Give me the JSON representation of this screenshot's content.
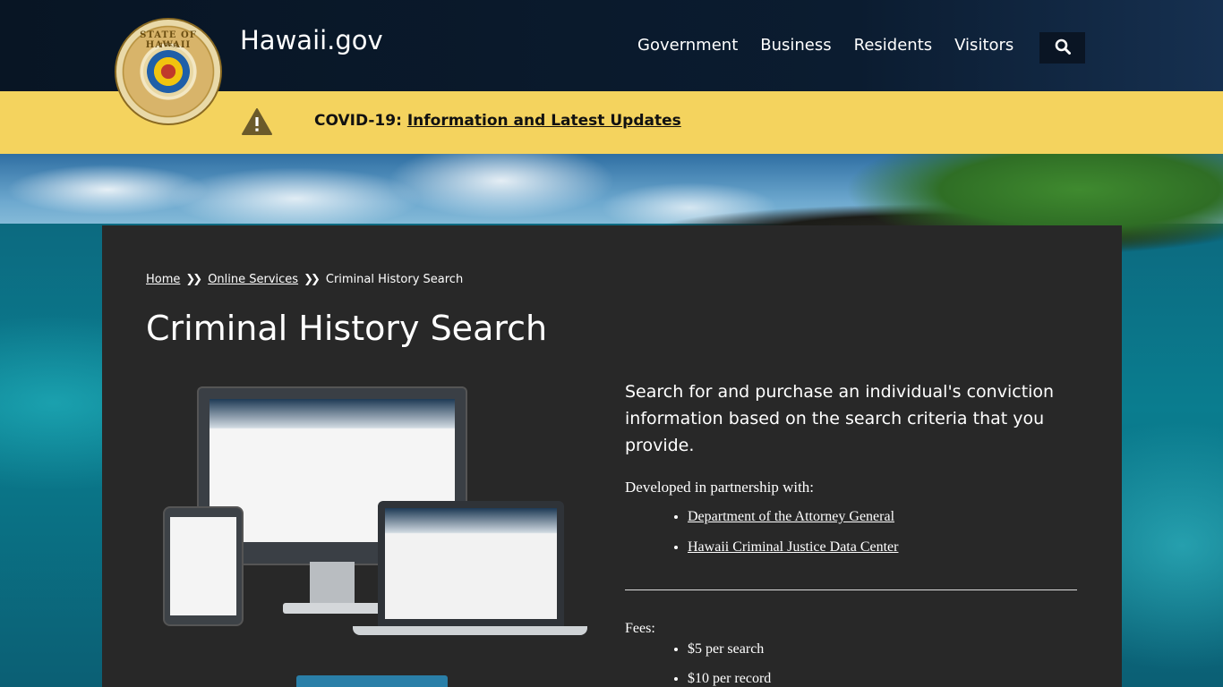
{
  "header": {
    "site_title": "Hawaii.gov",
    "seal_text": "STATE OF HAWAII",
    "seal_year": "1959",
    "nav": [
      {
        "label": "Government"
      },
      {
        "label": "Business"
      },
      {
        "label": "Residents"
      },
      {
        "label": "Visitors"
      }
    ],
    "search_icon": "search-icon"
  },
  "alert": {
    "prefix": "COVID-19:",
    "link_text": "Information and Latest Updates",
    "icon": "warning-icon",
    "color": "#f4d35e"
  },
  "breadcrumb": {
    "items": [
      "Home",
      "Online Services"
    ],
    "current": "Criminal History Search"
  },
  "page": {
    "title": "Criminal History Search",
    "intro": "Search for and purchase an individual's conviction information based on the search criteria that you provide.",
    "partner_label": "Developed in partnership with:",
    "partners": [
      "Department of the Attorney General",
      "Hawaii Criminal Justice Data Center"
    ],
    "fees_label": "Fees:",
    "fees": [
      "$5 per search",
      "$10 per record"
    ]
  },
  "colors": {
    "header_bg": "#0b1c30",
    "panel_bg": "#282828",
    "accent": "#2a7fa8"
  }
}
